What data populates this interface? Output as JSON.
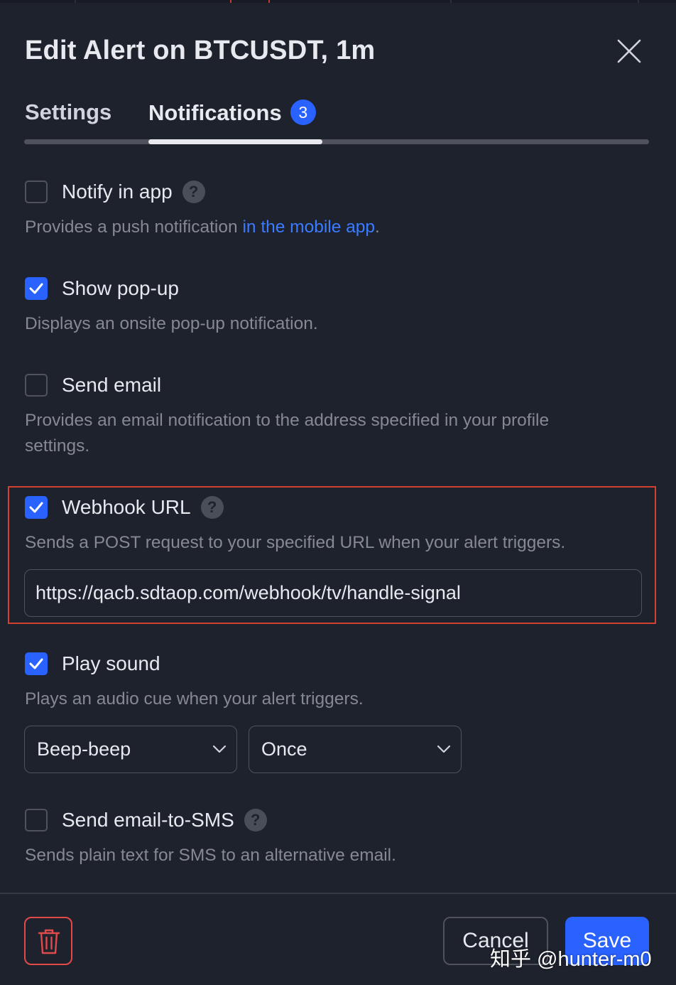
{
  "dialog": {
    "title": "Edit Alert on BTCUSDT, 1m"
  },
  "tabs": [
    {
      "label": "Settings",
      "active": false
    },
    {
      "label": "Notifications",
      "active": true,
      "badge": "3"
    }
  ],
  "options": [
    {
      "label": "Notify in app",
      "checked": false,
      "help": "?",
      "desc_prefix": "Provides a push notification ",
      "desc_link": "in the mobile app",
      "desc_suffix": "."
    },
    {
      "label": "Show pop-up",
      "checked": true,
      "desc": "Displays an onsite pop-up notification."
    },
    {
      "label": "Send email",
      "checked": false,
      "desc_line1": "Provides an email notification to the address specified in your profile",
      "desc_line2": "settings."
    },
    {
      "label": "Webhook URL",
      "checked": true,
      "help": "?",
      "desc": "Sends a POST request to your specified URL when your alert triggers.",
      "url_value": "https://qacb.sdtaop.com/webhook/tv/handle-signal"
    },
    {
      "label": "Play sound",
      "checked": true,
      "desc": "Plays an audio cue when your alert triggers.",
      "sound": "Beep-beep",
      "repeat": "Once"
    },
    {
      "label": "Send email-to-SMS",
      "checked": false,
      "help": "?",
      "desc": "Sends plain text for SMS to an alternative email."
    }
  ],
  "footer": {
    "cancel_label": "Cancel",
    "save_label": "Save"
  },
  "watermark": "知乎 @hunter-m0",
  "colors": {
    "background": "#1e222d",
    "accent": "#2962ff",
    "link": "#3b7bff",
    "danger": "#e04a4a",
    "highlight_box": "#d2402f"
  },
  "icons": {
    "close": "close-icon",
    "check": "check-icon",
    "help": "help-icon",
    "chevron": "chevron-down-icon",
    "trash": "trash-icon"
  }
}
